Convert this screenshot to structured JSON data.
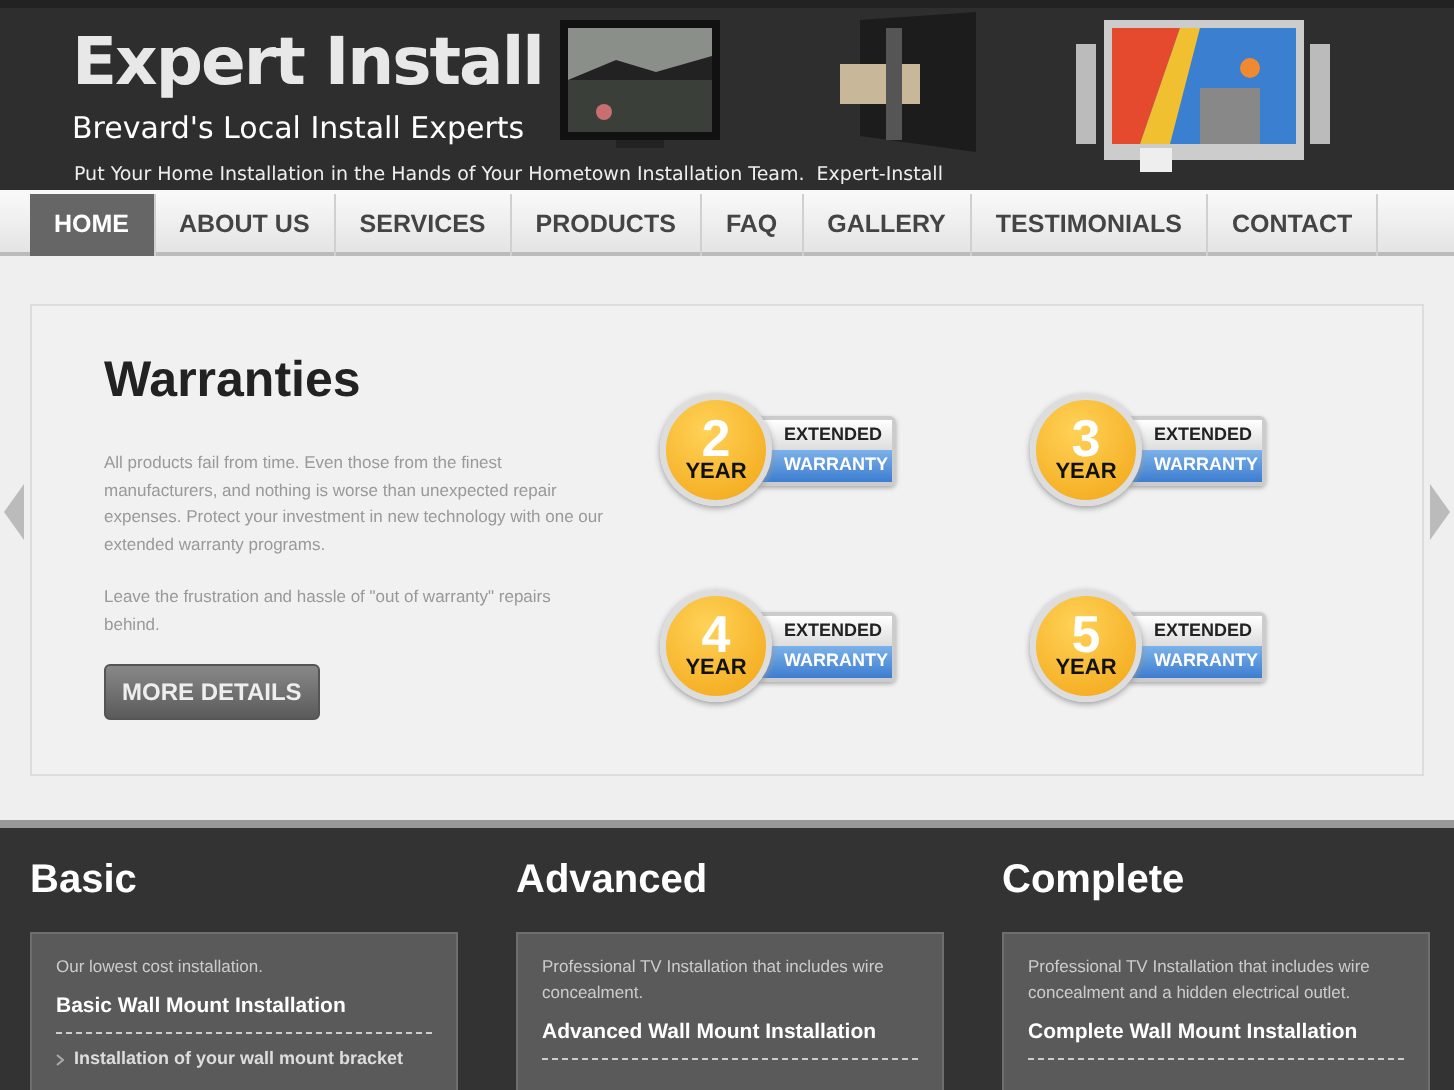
{
  "header": {
    "logo": "Expert Install",
    "tagline": "Brevard's Local Install Experts",
    "slogan": "Put Your Home Installation in the Hands of Your Hometown Installation Team.  Expert-Install"
  },
  "nav": [
    {
      "label": "HOME",
      "selected": true
    },
    {
      "label": "ABOUT US",
      "selected": false
    },
    {
      "label": "SERVICES",
      "selected": false
    },
    {
      "label": "PRODUCTS",
      "selected": false
    },
    {
      "label": "FAQ",
      "selected": false
    },
    {
      "label": "GALLERY",
      "selected": false
    },
    {
      "label": "TESTIMONIALS",
      "selected": false
    },
    {
      "label": "CONTACT",
      "selected": false
    }
  ],
  "feature": {
    "title": "Warranties",
    "paragraphs": [
      "All products fail from time. Even those from the finest manufacturers, and nothing is worse than unexpected repair expenses. Protect your investment in new technology with one our extended warranty programs.",
      "Leave the frustration and hassle of \"out of warranty\" repairs behind."
    ],
    "button": "MORE DETAILS",
    "badges": [
      {
        "number": "2",
        "unit": "YEAR",
        "line1": "EXTENDED",
        "line2": "WARRANTY"
      },
      {
        "number": "3",
        "unit": "YEAR",
        "line1": "EXTENDED",
        "line2": "WARRANTY"
      },
      {
        "number": "4",
        "unit": "YEAR",
        "line1": "EXTENDED",
        "line2": "WARRANTY"
      },
      {
        "number": "5",
        "unit": "YEAR",
        "line1": "EXTENDED",
        "line2": "WARRANTY"
      }
    ]
  },
  "packages": [
    {
      "title": "Basic",
      "intro": "Our lowest cost installation.",
      "name": "Basic Wall Mount Installation",
      "items": [
        "Installation of your wall mount bracket"
      ]
    },
    {
      "title": "Advanced",
      "intro": "Professional TV Installation that includes wire concealment.",
      "name": "Advanced Wall Mount Installation"
    },
    {
      "title": "Complete",
      "intro": "Professional TV Installation that includes wire concealment and a hidden electrical outlet.",
      "name": "Complete Wall Mount Installation"
    }
  ]
}
